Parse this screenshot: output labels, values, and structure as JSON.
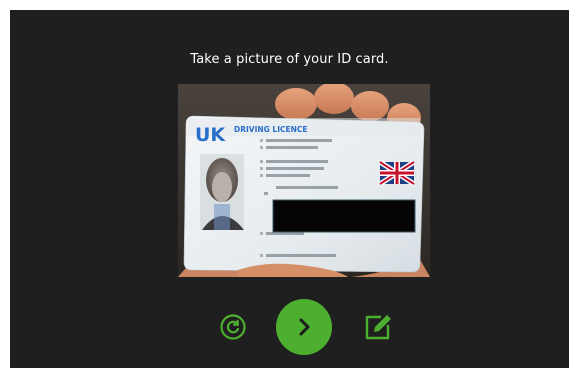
{
  "instruction": "Take a picture of your ID card.",
  "card": {
    "country": "UK",
    "title": "DRIVING LICENCE"
  },
  "controls": {
    "retake_icon": "refresh-icon",
    "next_icon": "chevron-right-icon",
    "edit_icon": "edit-icon"
  },
  "colors": {
    "screen_bg": "#1f1f1f",
    "accent_green": "#4caf30",
    "card_blue": "#2a6fc9"
  }
}
